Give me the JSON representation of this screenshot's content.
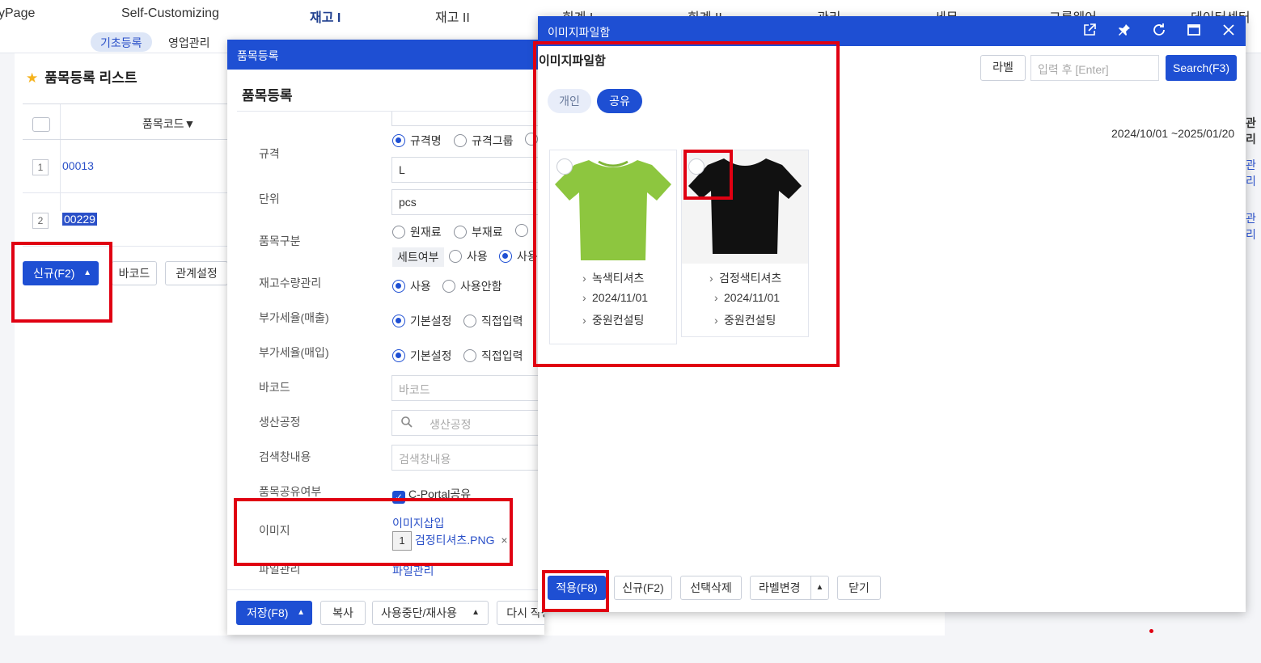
{
  "topnav": {
    "items": [
      "yPage",
      "Self-Customizing",
      "재고 I",
      "재고 II",
      "회계 I",
      "회계 II",
      "관리",
      "세무",
      "그룹웨어",
      "데이터센터"
    ]
  },
  "subnav": {
    "items": [
      "기초등록",
      "영업관리"
    ]
  },
  "list": {
    "title": "품목등록 리스트",
    "column_header": "품목코드▼",
    "rows": [
      {
        "num": "1",
        "code": "00013"
      },
      {
        "num": "2",
        "code": "00229"
      }
    ],
    "buttons": {
      "new": "신규(F2)",
      "barcode": "바코드",
      "relation": "관계설정"
    }
  },
  "item_dialog": {
    "header": "품목등록",
    "subtitle": "품목등록",
    "fields": {
      "spec_label": "규격",
      "spec_options": [
        "규격명",
        "규격그룹"
      ],
      "spec_value": "L",
      "unit_label": "단위",
      "unit_value": "pcs",
      "type_label": "품목구분",
      "type_options": [
        "원재료",
        "부재료"
      ],
      "set_tag": "세트여부",
      "set_options": [
        "사용",
        "사용"
      ],
      "stock_label": "재고수량관리",
      "stock_options": [
        "사용",
        "사용안함"
      ],
      "vat_sales_label": "부가세율(매출)",
      "vat_sales_options": [
        "기본설정",
        "직접입력"
      ],
      "vat_purchase_label": "부가세율(매입)",
      "vat_purchase_options": [
        "기본설정",
        "직접입력"
      ],
      "barcode_label": "바코드",
      "barcode_placeholder": "바코드",
      "process_label": "생산공정",
      "process_placeholder": "생산공정",
      "search_label": "검색창내용",
      "search_placeholder": "검색창내용",
      "share_label": "품목공유여부",
      "share_option": "C-Portal공유",
      "image_label": "이미지",
      "image_insert": "이미지삽입",
      "image_count": "1",
      "image_file": "검정티셔츠.PNG",
      "image_remove": "×",
      "file_label": "파일관리",
      "file_value": "파일관리"
    },
    "footer": {
      "save": "저장(F8)",
      "copy": "복사",
      "stop": "사용중단/재사용",
      "rewrite": "다시 작성"
    }
  },
  "image_dialog": {
    "header": "이미지파일함",
    "panel_title": "이미지파일함",
    "toggle": {
      "personal": "개인",
      "shared": "공유"
    },
    "search": {
      "label_button": "라벨",
      "placeholder": "입력 후 [Enter]",
      "search_button": "Search(F3)"
    },
    "date_range": "2024/10/01 ~2025/01/20",
    "cards": [
      {
        "name": "녹색티셔츠",
        "date": "2024/11/01",
        "owner": "중원컨설팅",
        "shirt_color": "#8dc63f"
      },
      {
        "name": "검정색티셔츠",
        "date": "2024/11/01",
        "owner": "중원컨설팅",
        "shirt_color": "#111111"
      }
    ],
    "footer": {
      "apply": "적용(F8)",
      "new": "신규(F2)",
      "delete": "선택삭제",
      "relabel": "라벨변경",
      "close": "닫기"
    }
  },
  "edge": {
    "manage": "관리",
    "manage1": "관리",
    "manage2": "관리"
  },
  "colors": {
    "primary": "#1e4fd3",
    "highlight": "#e00012"
  }
}
